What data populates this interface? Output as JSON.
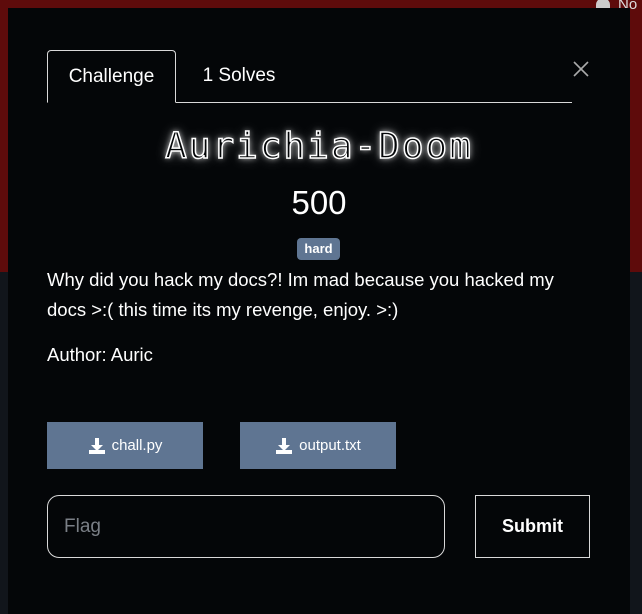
{
  "background": {
    "nav_partial_text": "No"
  },
  "modal": {
    "tabs": [
      {
        "label": "Challenge",
        "active": true
      },
      {
        "label": "1 Solves",
        "active": false
      }
    ],
    "challenge": {
      "name": "Aurichia-Doom",
      "points": "500",
      "difficulty": "hard",
      "description": "Why did you hack my docs?! Im mad because you hacked my docs >:( this time its my revenge, enjoy. >:)",
      "author": "Author: Auric"
    },
    "files": [
      {
        "label": "chall.py",
        "icon": "download-icon"
      },
      {
        "label": "output.txt",
        "icon": "download-icon"
      }
    ],
    "flag": {
      "value": "",
      "placeholder": "Flag"
    },
    "submit_label": "Submit"
  },
  "colors": {
    "badge": "#5f7592",
    "download_button": "#5f7592",
    "modal_bg": "#040608",
    "backdrop_red": "#5e0b0b"
  }
}
